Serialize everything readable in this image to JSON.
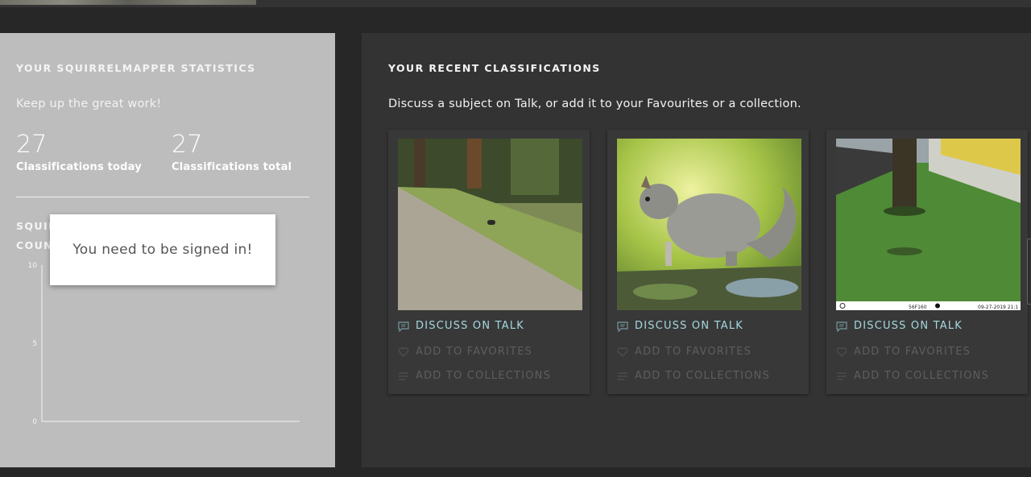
{
  "stats_panel": {
    "heading": "YOUR SQUIRRELMAPPER STATISTICS",
    "subtitle": "Keep up the great work!",
    "today_value": "27",
    "today_label": "Classifications today",
    "total_value": "27",
    "total_label": "Classifications total",
    "chart_title": "SQUIRRELMAPPER CLASSIFICATIONS COUNT",
    "chart_data": {
      "type": "bar",
      "categories": [],
      "values": [],
      "title": "",
      "xlabel": "",
      "ylabel": "",
      "ylim": [
        0,
        10
      ],
      "yticks": [
        "10",
        "5",
        "0"
      ]
    }
  },
  "toast": {
    "message": "You need to be signed in!"
  },
  "recent_panel": {
    "heading": "YOUR RECENT CLASSIFICATIONS",
    "subtitle": "Discuss a subject on Talk, or add it to your Favourites or a collection.",
    "cards": [
      {
        "talk": "DISCUSS ON TALK",
        "favorite": "ADD TO FAVORITES",
        "collection": "ADD TO COLLECTIONS"
      },
      {
        "talk": "DISCUSS ON TALK",
        "favorite": "ADD TO FAVORITES",
        "collection": "ADD TO COLLECTIONS"
      },
      {
        "talk": "DISCUSS ON TALK",
        "favorite": "ADD TO FAVORITES",
        "collection": "ADD TO COLLECTIONS",
        "camera_stamp_left": "56F160",
        "camera_stamp_right": "09-27-2019 21:1"
      }
    ]
  },
  "colors": {
    "accent_talk": "#a5d8e0",
    "panel_light": "#bdbdbd",
    "panel_dark": "#333333"
  },
  "icons": {
    "talk": "speech-bubble-icon",
    "favorite": "heart-icon",
    "collection": "list-icon"
  }
}
